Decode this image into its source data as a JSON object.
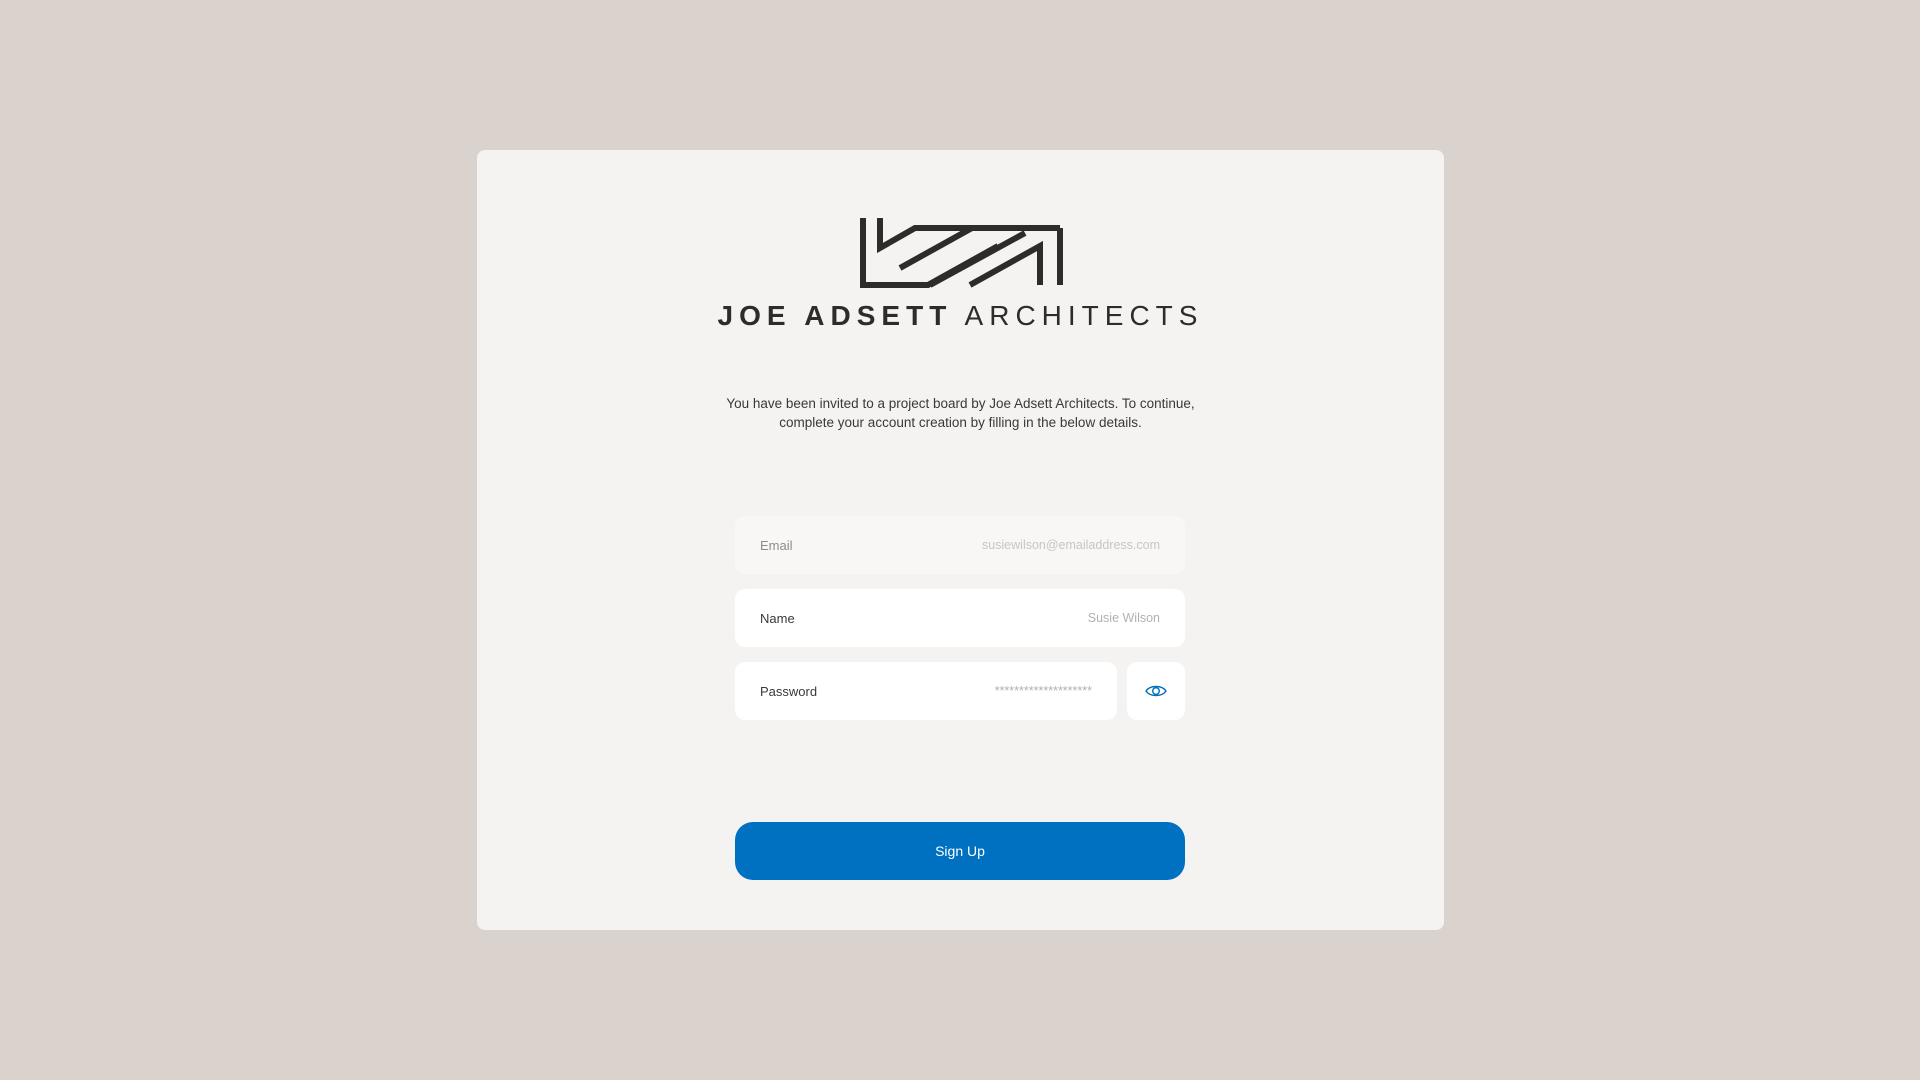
{
  "brand": {
    "name_bold": "JOE ADSETT",
    "name_light": "ARCHITECTS"
  },
  "intro": {
    "line1": "You have been invited to a project board by Joe Adsett Architects. To continue,",
    "line2": "complete your account creation by filling in the below details."
  },
  "form": {
    "email": {
      "label": "Email",
      "value": "susiewilson@emailaddress.com"
    },
    "name": {
      "label": "Name",
      "value": "Susie Wilson"
    },
    "password": {
      "label": "Password",
      "value": "********************"
    },
    "toggle_icon": "eye-icon",
    "submit_label": "Sign Up"
  },
  "colors": {
    "background": "#dad2cc",
    "card": "#f4f3f1",
    "accent": "#0070c0",
    "logo": "#2e2b2a"
  }
}
